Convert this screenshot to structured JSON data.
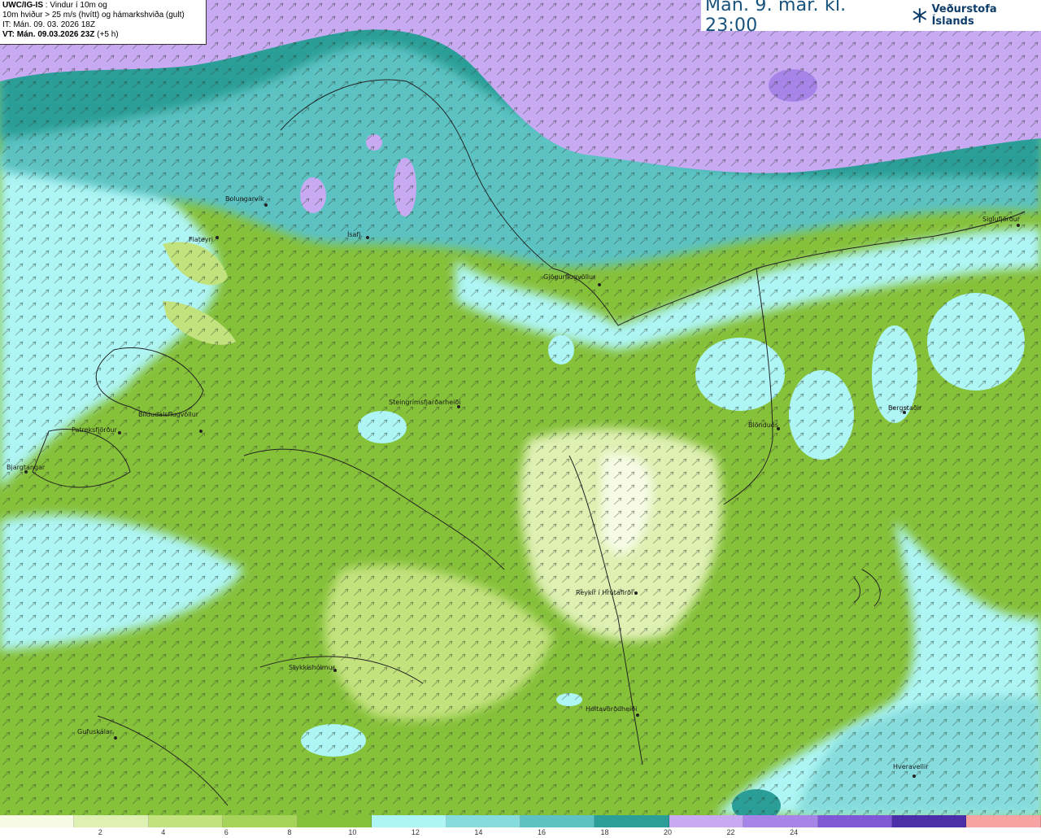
{
  "info": {
    "model": "UWC/IG-IS",
    "title_suffix": " : Vindur í 10m og",
    "line2": "10m hviður > 25 m/s (hvítt) og hámarkshviða (gult)",
    "it": "IT: Mán. 09. 03. 2026 18Z",
    "vt_label": "VT: Mán. 09.03.2026 23Z",
    "vt_offset": " (+5 h)"
  },
  "header": {
    "valid_time": "Mán. 9. mar. kl. 23:00",
    "brand": "Veðurstofa Íslands"
  },
  "stations": [
    {
      "name": "Bolungarvík"
    },
    {
      "name": "Flateyri"
    },
    {
      "name": "Gjögurflugvöllur"
    },
    {
      "name": "Siglufjörður"
    },
    {
      "name": "Steingrímsfjarðarheiði"
    },
    {
      "name": "Bíldudalsflugvöllur"
    },
    {
      "name": "Patreksfjörður"
    },
    {
      "name": "Bjargtangar"
    },
    {
      "name": "Blönduós"
    },
    {
      "name": "Bergstaðir"
    },
    {
      "name": "Reykir í Hrútafirði"
    },
    {
      "name": "Stykkishólmur"
    },
    {
      "name": "Holtavörðuheiði"
    },
    {
      "name": "Gufuskálar"
    },
    {
      "name": "Hveravellir"
    },
    {
      "name": "Ísafj."
    }
  ],
  "legend": {
    "unit_values": [
      "2",
      "4",
      "6",
      "8",
      "10",
      "12",
      "14",
      "16",
      "18",
      "20",
      "22",
      "24"
    ],
    "colors": [
      "#f7fbe6",
      "#dff0b3",
      "#c2e27e",
      "#a6d35a",
      "#86c13a",
      "#aef5f5",
      "#86dcdc",
      "#5cc2c2",
      "#2a9e97",
      "#c7aaf2",
      "#a784e8",
      "#7f58d6",
      "#4b2ea8",
      "#f7a3a3"
    ]
  },
  "colors": {
    "sea_low": "#86c13a",
    "sea_mid": "#5cc2c2",
    "sea_high": "#2a9e97",
    "storm": "#c7aaf2",
    "title_text": "#17527d"
  }
}
